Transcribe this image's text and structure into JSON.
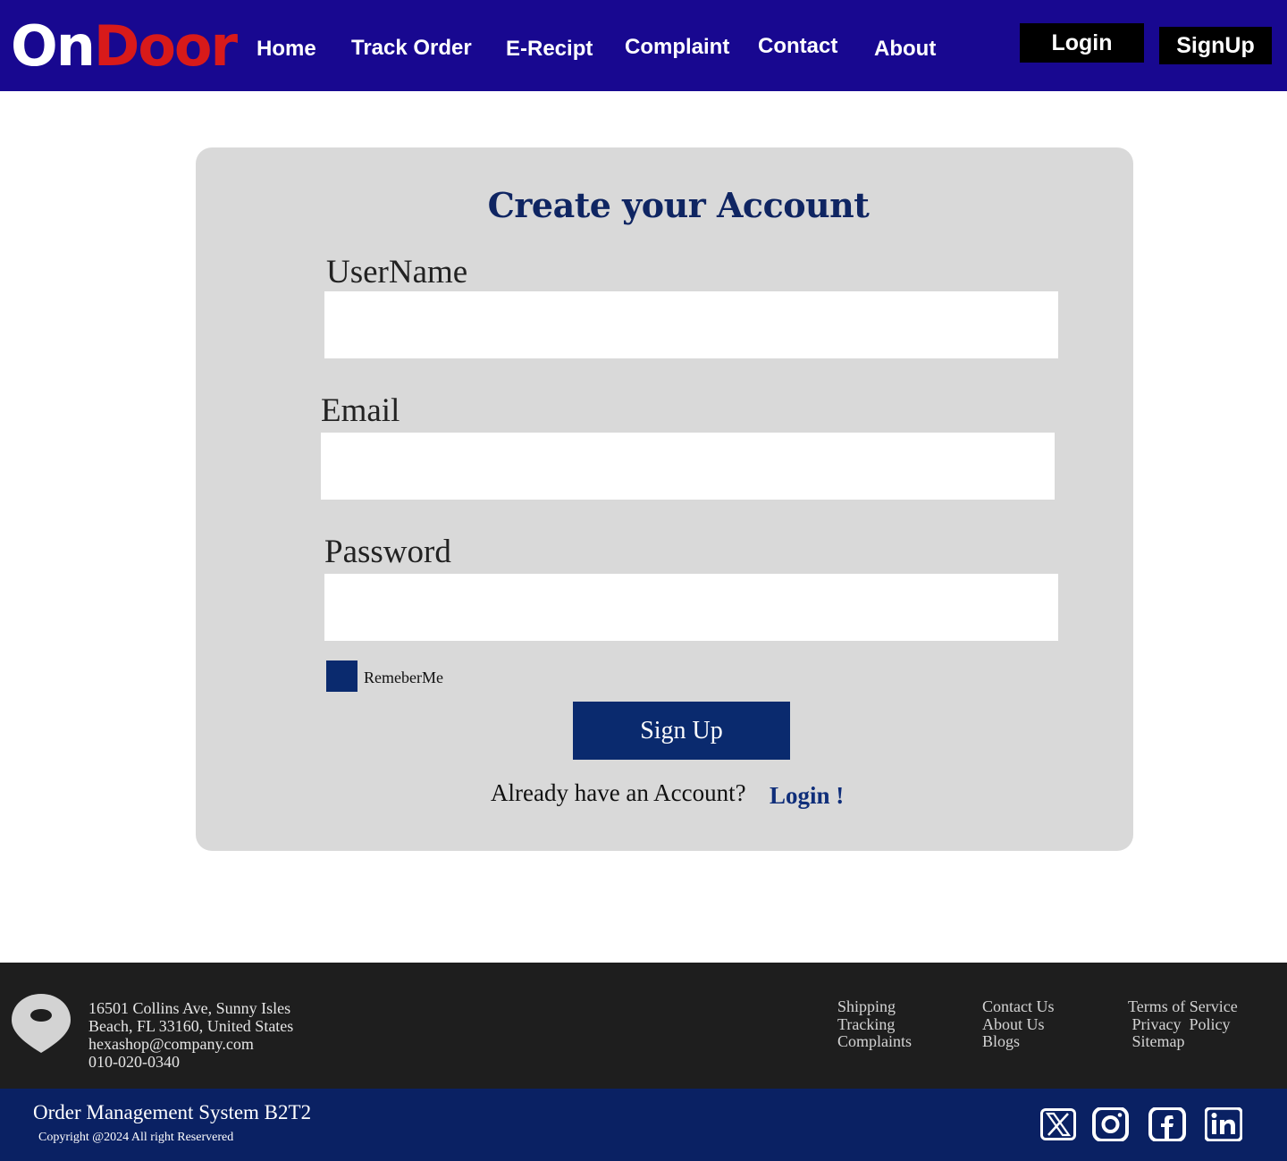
{
  "brand": {
    "part1": "On",
    "part2": "Door"
  },
  "nav": {
    "home": "Home",
    "track_order": "Track Order",
    "e_recipt": "E-Recipt",
    "complaint": "Complaint",
    "contact": "Contact",
    "about": "About"
  },
  "auth": {
    "login": "Login",
    "signup": "SignUp"
  },
  "form": {
    "title": "Create your Account",
    "username_label": "UserName",
    "username_value": "",
    "email_label": "Email",
    "email_value": "",
    "password_label": "Password",
    "password_value": "",
    "remember_label": "RemeberMe",
    "remember_checked": true,
    "submit_label": "Sign Up",
    "already_text": "Already have an Account?",
    "login_link": "Login !"
  },
  "footer": {
    "address_line1": "16501 Collins Ave, Sunny Isles",
    "address_line2": "Beach, FL 33160, United States",
    "email": "hexashop@company.com",
    "phone": "010-020-0340",
    "col1": [
      "Shipping",
      "Tracking",
      "Complaints"
    ],
    "col2": [
      "Contact Us",
      "About Us",
      "Blogs"
    ],
    "col3": [
      "Terms of Service",
      " Privacy  Policy",
      " Sitemap"
    ],
    "system_name": "Order Management System B2T2",
    "copyright": "Copyright @2024 All right Reservered",
    "social_icons": [
      "x-icon",
      "instagram-icon",
      "facebook-icon",
      "linkedin-icon"
    ]
  },
  "colors": {
    "header_bg": "#180890",
    "brand_red": "#d81a1a",
    "primary_navy": "#0a2a6e",
    "card_bg": "#d9d9d9",
    "footer_bg": "#1e1e1e",
    "bottom_bar_bg": "#0a2163"
  }
}
